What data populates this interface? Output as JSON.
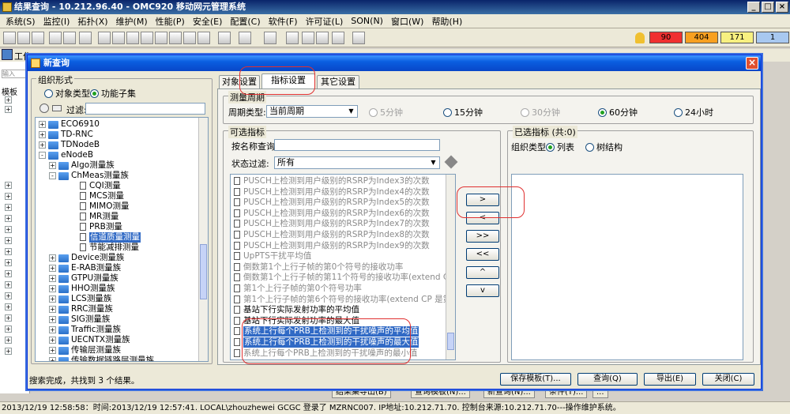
{
  "app": {
    "title": "结果查询 - 10.212.96.40 - OMC920 移动网元管理系统",
    "menus": [
      "系统(S)",
      "监控(I)",
      "拓扑(X)",
      "维护(M)",
      "性能(P)",
      "安全(E)",
      "配置(C)",
      "软件(F)",
      "许可证(L)",
      "SON(N)",
      "窗口(W)",
      "帮助(H)"
    ],
    "alarms": [
      {
        "value": "90",
        "color": "#f03030"
      },
      {
        "value": "404",
        "color": "#f8a020"
      },
      {
        "value": "171",
        "color": "#f8f080"
      },
      {
        "value": "1",
        "color": "#a8c8f0"
      }
    ],
    "work_tab": "工作",
    "left_input_placeholder": "输入",
    "left_root": "模板",
    "status_text": "2013/12/19 12:58:58：时间:2013/12/19 12:57:41. LOCAL\\zhouzhewei GCGC 登录了 MZRNC007. IP地址:10.212.71.70. 控制台来源:10.212.71.70---操作维护系统。",
    "bg_buttons": [
      "结果集导出(B)",
      "查询模板(N)...",
      "新查询(N)...",
      "条件(T)...",
      "..."
    ]
  },
  "dialog": {
    "title": "新查询",
    "group_form": {
      "title": "组织形式",
      "opt_object": "对象类型",
      "opt_function": "功能子集",
      "filter_label": "过滤:"
    },
    "tree": [
      {
        "label": "ECO6910",
        "lvl": 0,
        "type": "folder",
        "exp": "+"
      },
      {
        "label": "TD-RNC",
        "lvl": 0,
        "type": "folder",
        "exp": "+"
      },
      {
        "label": "TDNodeB",
        "lvl": 0,
        "type": "folder",
        "exp": "+"
      },
      {
        "label": "eNodeB",
        "lvl": 0,
        "type": "folder",
        "exp": "-"
      },
      {
        "label": "Algo测量族",
        "lvl": 1,
        "type": "folder",
        "exp": "+"
      },
      {
        "label": "ChMeas测量族",
        "lvl": 1,
        "type": "folder",
        "exp": "-"
      },
      {
        "label": "CQI测量",
        "lvl": 2,
        "type": "doc"
      },
      {
        "label": "MCS测量",
        "lvl": 2,
        "type": "doc"
      },
      {
        "label": "MIMO测量",
        "lvl": 2,
        "type": "doc"
      },
      {
        "label": "MR测量",
        "lvl": 2,
        "type": "doc"
      },
      {
        "label": "PRB测量",
        "lvl": 2,
        "type": "doc"
      },
      {
        "label": "信道质量测量",
        "lvl": 2,
        "type": "doc",
        "selected": true
      },
      {
        "label": "节能减排测量",
        "lvl": 2,
        "type": "doc"
      },
      {
        "label": "Device测量族",
        "lvl": 1,
        "type": "folder",
        "exp": "+"
      },
      {
        "label": "E-RAB测量族",
        "lvl": 1,
        "type": "folder",
        "exp": "+"
      },
      {
        "label": "GTPU测量族",
        "lvl": 1,
        "type": "folder",
        "exp": "+"
      },
      {
        "label": "HHO测量族",
        "lvl": 1,
        "type": "folder",
        "exp": "+"
      },
      {
        "label": "LCS测量族",
        "lvl": 1,
        "type": "folder",
        "exp": "+"
      },
      {
        "label": "RRC测量族",
        "lvl": 1,
        "type": "folder",
        "exp": "+"
      },
      {
        "label": "SIG测量族",
        "lvl": 1,
        "type": "folder",
        "exp": "+"
      },
      {
        "label": "Traffic测量族",
        "lvl": 1,
        "type": "folder",
        "exp": "+"
      },
      {
        "label": "UECNTX测量族",
        "lvl": 1,
        "type": "folder",
        "exp": "+"
      },
      {
        "label": "传输层测量族",
        "lvl": 1,
        "type": "folder",
        "exp": "+"
      },
      {
        "label": "传输数据链路层测量族",
        "lvl": 1,
        "type": "folder",
        "exp": "+"
      }
    ],
    "tabs": [
      "对象设置",
      "指标设置",
      "其它设置"
    ],
    "period": {
      "title": "测量周期",
      "type_label": "周期类型:",
      "type_value": "当前周期",
      "options": [
        {
          "label": "5分钟",
          "on": false,
          "disabled": true
        },
        {
          "label": "15分钟",
          "on": false,
          "disabled": false
        },
        {
          "label": "30分钟",
          "on": false,
          "disabled": true
        },
        {
          "label": "60分钟",
          "on": true,
          "disabled": false
        },
        {
          "label": "24小时",
          "on": false,
          "disabled": false
        }
      ]
    },
    "available": {
      "title": "可选指标",
      "name_query_label": "按名称查询:",
      "status_filter_label": "状态过滤:",
      "status_filter_value": "所有",
      "items": [
        {
          "label": "PUSCH上检测到用户级别的RSRP为Index3的次数",
          "style": "gray"
        },
        {
          "label": "PUSCH上检测到用户级别的RSRP为Index4的次数",
          "style": "gray"
        },
        {
          "label": "PUSCH上检测到用户级别的RSRP为Index5的次数",
          "style": "gray"
        },
        {
          "label": "PUSCH上检测到用户级别的RSRP为Index6的次数",
          "style": "gray"
        },
        {
          "label": "PUSCH上检测到用户级别的RSRP为Index7的次数",
          "style": "gray"
        },
        {
          "label": "PUSCH上检测到用户级别的RSRP为Index8的次数",
          "style": "gray"
        },
        {
          "label": "PUSCH上检测到用户级别的RSRP为Index9的次数",
          "style": "gray"
        },
        {
          "label": "UpPTS干扰平均值",
          "style": "gray"
        },
        {
          "label": "倒数第1个上行子帧的第0个符号的接收功率",
          "style": "gray"
        },
        {
          "label": "倒数第1个上行子帧的第11个符号的接收功率(extend CP 是第9)",
          "style": "gray"
        },
        {
          "label": "第1个上行子帧的第0个符号功率",
          "style": "gray"
        },
        {
          "label": "第1个上行子帧的第6个符号的接收功率(extend CP 是第4)",
          "style": "gray"
        },
        {
          "label": "基站下行实际发射功率的平均值",
          "style": "normal"
        },
        {
          "label": "基站下行实际发射功率的最大值",
          "style": "normal"
        },
        {
          "label": "系统上行每个PRB上检测到的干扰噪声的平均值",
          "style": "selected"
        },
        {
          "label": "系统上行每个PRB上检测到的干扰噪声的最大值",
          "style": "selected"
        },
        {
          "label": "系统上行每个PRB上检测到的干扰噪声的最小值",
          "style": "gray"
        }
      ]
    },
    "move_buttons": [
      ">",
      "<",
      ">>",
      "<<",
      "^",
      "v"
    ],
    "selected": {
      "title": "已选指标 (共:0)",
      "org_label": "组织类型:",
      "opt_list": "列表",
      "opt_tree": "树结构"
    },
    "status": "搜索完成，共找到 3 个结果。",
    "buttons": {
      "save": "保存模板(T)...",
      "query": "查询(Q)",
      "export": "导出(E)",
      "close": "关闭(C)"
    }
  }
}
